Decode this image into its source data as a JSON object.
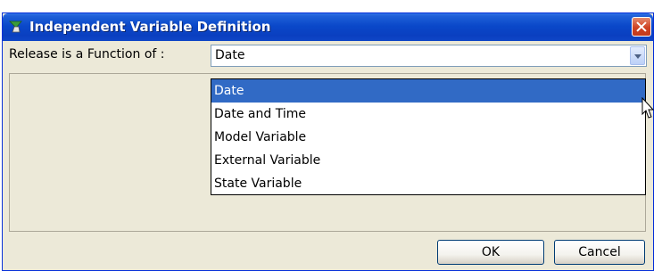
{
  "window": {
    "title": "Independent Variable Definition",
    "app_icon": "green-arrow-icon",
    "close_icon": "close-icon"
  },
  "form": {
    "label": "Release is a Function of :",
    "combo_value": "Date"
  },
  "dropdown": {
    "options": [
      "Date",
      "Date and Time",
      "Model Variable",
      "External Variable",
      "State Variable"
    ],
    "selected_index": 0
  },
  "buttons": {
    "ok": "OK",
    "cancel": "Cancel"
  },
  "colors": {
    "titlebar": "#0a48c9",
    "selection": "#316ac5",
    "close": "#cf4323"
  }
}
